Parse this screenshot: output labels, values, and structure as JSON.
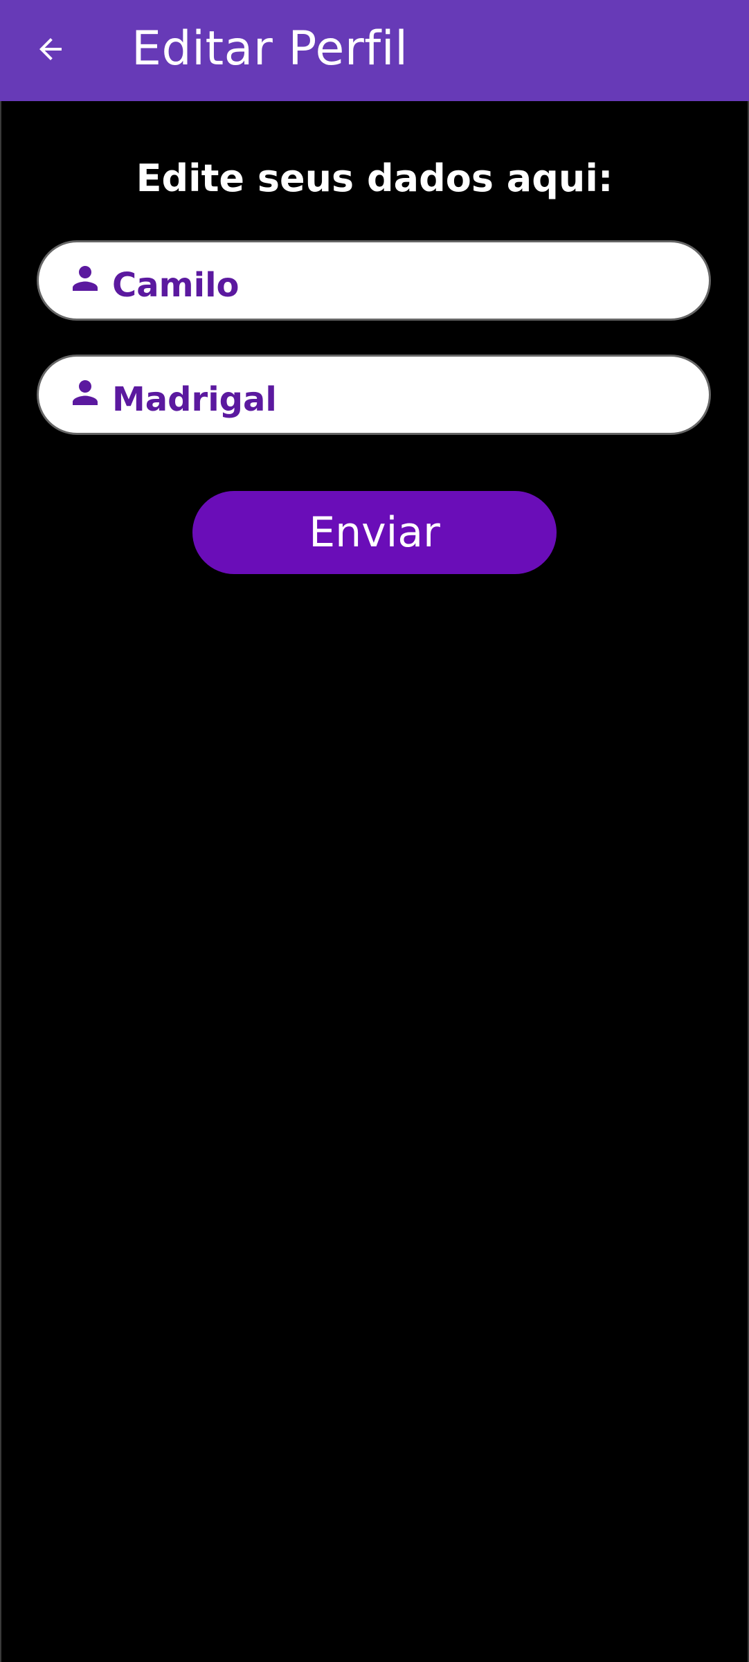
{
  "app_bar": {
    "title": "Editar Perfil",
    "back_icon": "arrow-back-icon",
    "background_color": "#673AB7"
  },
  "form": {
    "heading": "Edite seus dados aqui:",
    "fields": [
      {
        "icon": "person-icon",
        "value": "Camilo"
      },
      {
        "icon": "person-icon",
        "value": "Madrigal"
      }
    ],
    "submit_label": "Enviar",
    "submit_color": "#6A0DB8",
    "field_text_color": "#5B199F"
  }
}
